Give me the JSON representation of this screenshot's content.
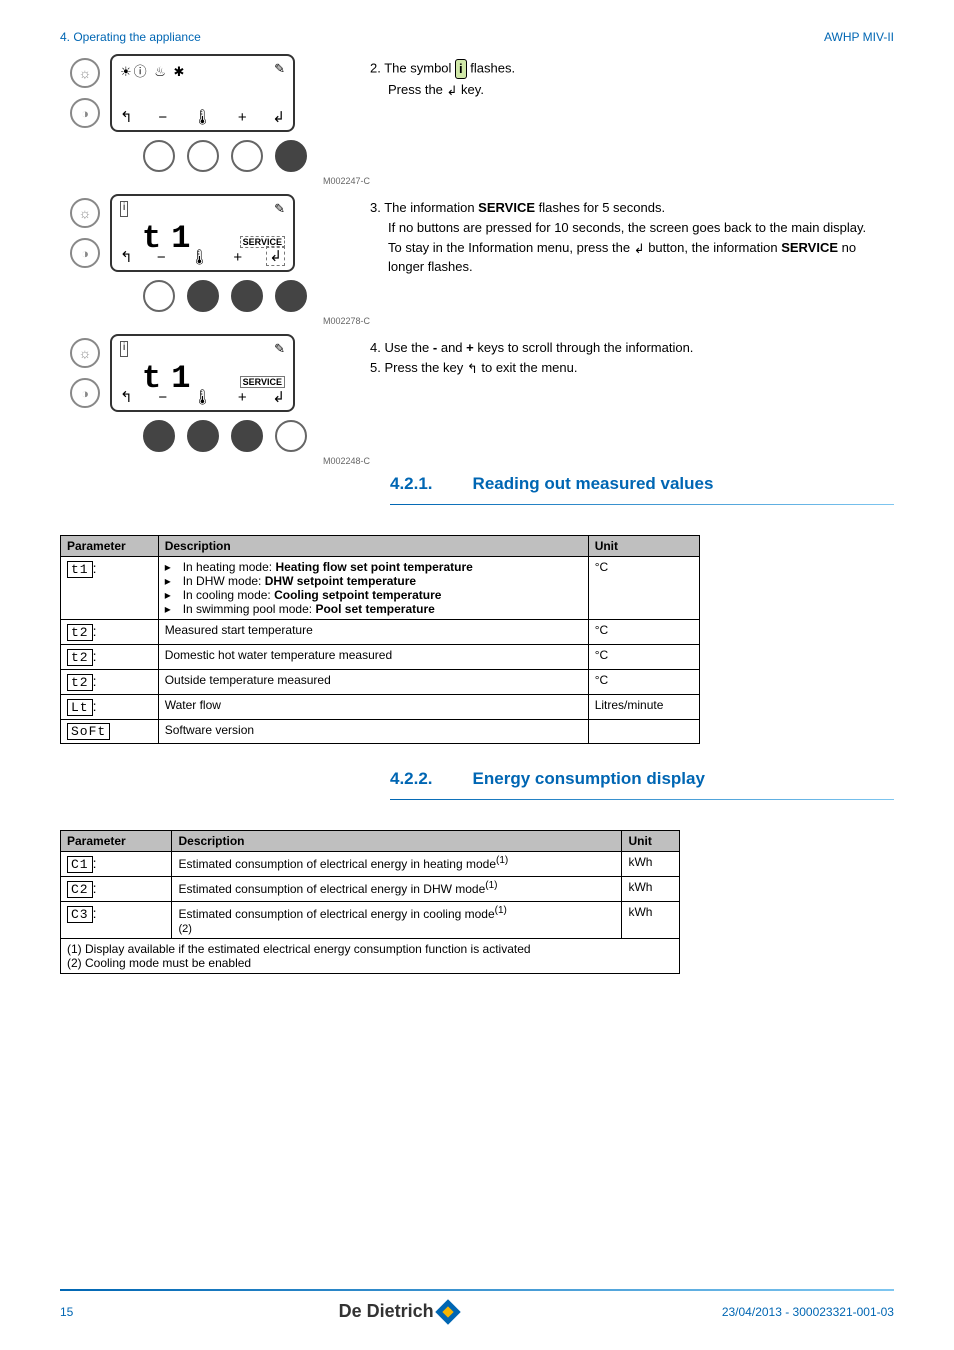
{
  "header": {
    "left": "4.  Operating the appliance",
    "right": "AWHP MIV-II"
  },
  "steps": {
    "s2": {
      "num": "2.",
      "line1_a": "The symbol ",
      "line1_b": " flashes.",
      "line2_a": "Press the ",
      "line2_b": " key.",
      "imgcode": "M002247-C"
    },
    "s3": {
      "num": "3.",
      "line1_a": "The information ",
      "line1_b": "SERVICE",
      "line1_c": " flashes for 5 seconds.",
      "line2": "If no buttons are pressed for 10 seconds, the screen goes back to the main display.",
      "line3_a": "To stay in the Information menu, press the ",
      "line3_b": " button, the information ",
      "line3_c": "SERVICE",
      "line3_d": " no longer flashes.",
      "imgcode": "M002278-C"
    },
    "s4": {
      "num": "4.",
      "text_a": "Use the ",
      "text_b": "-",
      "text_c": " and ",
      "text_d": "+",
      "text_e": " keys to scroll through the information."
    },
    "s5": {
      "num": "5.",
      "text_a": "Press the key ",
      "text_b": " to exit the menu.",
      "imgcode": "M002248-C"
    }
  },
  "lcd": {
    "service_label": "SERVICE",
    "big": "t1"
  },
  "section1": {
    "num": "4.2.1.",
    "title": "Reading out measured values"
  },
  "section2": {
    "num": "4.2.2.",
    "title": "Energy consumption display"
  },
  "table1": {
    "h1": "Parameter",
    "h2": "Description",
    "h3": "Unit",
    "r1": {
      "p": "t1",
      "d1a": "In heating mode: ",
      "d1b": "Heating flow set point temperature",
      "d2a": "In DHW mode: ",
      "d2b": "DHW setpoint temperature",
      "d3a": "In cooling mode: ",
      "d3b": "Cooling setpoint temperature",
      "d4a": "In swimming pool mode: ",
      "d4b": "Pool set temperature",
      "u": "°C"
    },
    "r2": {
      "p": "t2",
      "d": "Measured start temperature",
      "u": "°C"
    },
    "r3": {
      "p": "t2",
      "d": "Domestic hot water temperature measured",
      "u": "°C"
    },
    "r4": {
      "p": "t2",
      "d": "Outside temperature measured",
      "u": "°C"
    },
    "r5": {
      "p": "Lt",
      "d": "Water flow",
      "u": "Litres/minute"
    },
    "r6": {
      "p": "SoFt",
      "d": "Software version",
      "u": ""
    }
  },
  "table2": {
    "h1": "Parameter",
    "h2": "Description",
    "h3": "Unit",
    "r1": {
      "p": "C1",
      "d": "Estimated consumption of electrical energy in heating mode",
      "sup": "(1)",
      "u": "kWh"
    },
    "r2": {
      "p": "C2",
      "d": "Estimated consumption of electrical energy in DHW mode",
      "sup": "(1)",
      "u": "kWh"
    },
    "r3": {
      "p": "C3",
      "d": "Estimated consumption of electrical energy in cooling mode",
      "sup1": "(1)",
      "sup2": "(2)",
      "u": "kWh"
    },
    "fn1": "(1)   Display available if the estimated electrical energy consumption function is activated",
    "fn2": "(2)   Cooling mode must be enabled"
  },
  "footer": {
    "page": "15",
    "logo": "De Dietrich",
    "date": "23/04/2013 - 300023321-001-03"
  },
  "chart_data": {
    "type": "table",
    "tables": [
      {
        "title": "Reading out measured values",
        "columns": [
          "Parameter",
          "Description",
          "Unit"
        ],
        "rows": [
          [
            "t1",
            "In heating mode: Heating flow set point temperature / In DHW mode: DHW setpoint temperature / In cooling mode: Cooling setpoint temperature / In swimming pool mode: Pool set temperature",
            "°C"
          ],
          [
            "t2",
            "Measured start temperature",
            "°C"
          ],
          [
            "t2",
            "Domestic hot water temperature measured",
            "°C"
          ],
          [
            "t2",
            "Outside temperature measured",
            "°C"
          ],
          [
            "Lt",
            "Water flow",
            "Litres/minute"
          ],
          [
            "SoFt",
            "Software version",
            ""
          ]
        ]
      },
      {
        "title": "Energy consumption display",
        "columns": [
          "Parameter",
          "Description",
          "Unit"
        ],
        "rows": [
          [
            "C1",
            "Estimated consumption of electrical energy in heating mode (1)",
            "kWh"
          ],
          [
            "C2",
            "Estimated consumption of electrical energy in DHW mode (1)",
            "kWh"
          ],
          [
            "C3",
            "Estimated consumption of electrical energy in cooling mode (1)(2)",
            "kWh"
          ]
        ],
        "footnotes": [
          "(1) Display available if the estimated electrical energy consumption function is activated",
          "(2) Cooling mode must be enabled"
        ]
      }
    ]
  }
}
